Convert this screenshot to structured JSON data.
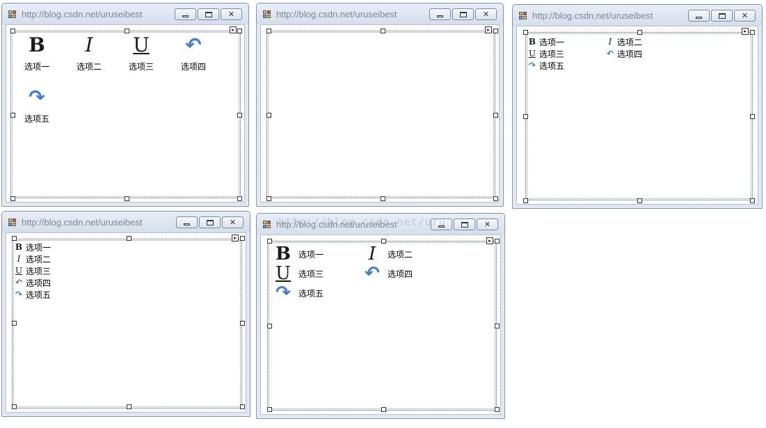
{
  "windows": [
    {
      "title": "http://blog.csdn.net/uruseibest",
      "view": "large-icon"
    },
    {
      "title": "http://blog.csdn.net/uruseibest",
      "view": "empty"
    },
    {
      "title": "http://blog.csdn.net/uruseibest",
      "view": "small-icon"
    },
    {
      "title": "http://blog.csdn.net/uruseibest",
      "view": "list"
    },
    {
      "title": "http://blog.csdn.net/uruseibest",
      "view": "tile"
    }
  ],
  "items": [
    {
      "label": "选项一",
      "icon": "bold-icon",
      "glyph": "B"
    },
    {
      "label": "选项二",
      "icon": "italic-icon",
      "glyph": "I"
    },
    {
      "label": "选项三",
      "icon": "underline-icon",
      "glyph": "U"
    },
    {
      "label": "选项四",
      "icon": "undo-icon",
      "glyph": "↶"
    },
    {
      "label": "选项五",
      "icon": "redo-icon",
      "glyph": "↷"
    }
  ],
  "watermark": "http://blog.csdn.net/uru",
  "colors": {
    "title_text": "#7d8794",
    "frame": "#dfe7f1",
    "arrow_icon": "#3f7ccf"
  }
}
